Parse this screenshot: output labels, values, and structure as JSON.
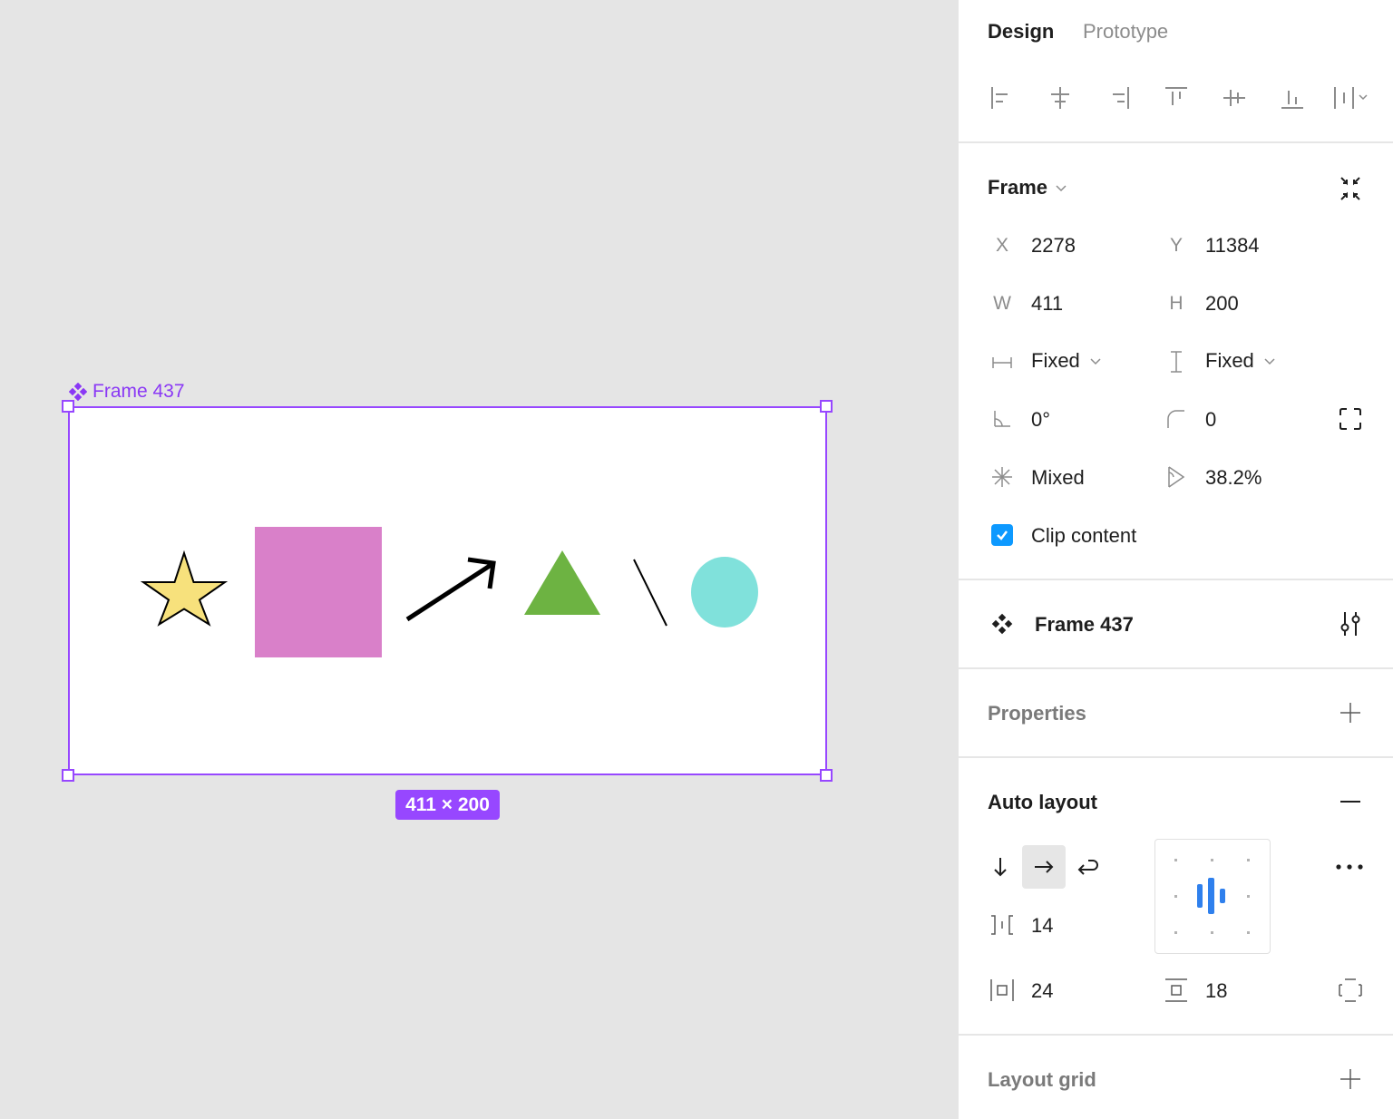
{
  "canvas": {
    "frame_label": "Frame 437",
    "size_badge": "411 × 200",
    "colors": {
      "selection": "#9747ff",
      "star": "#f7e17c",
      "square": "#d980c9",
      "triangle": "#6db342",
      "circle": "#80e1db"
    }
  },
  "panel": {
    "tabs": [
      {
        "label": "Design",
        "active": true
      },
      {
        "label": "Prototype",
        "active": false
      }
    ],
    "align_icons": [
      "align-left-icon",
      "align-horizontal-center-icon",
      "align-right-icon",
      "align-top-icon",
      "align-vertical-center-icon",
      "align-bottom-icon",
      "distribute-icon"
    ],
    "frame": {
      "title": "Frame",
      "x_label": "X",
      "x_value": "2278",
      "y_label": "Y",
      "y_value": "11384",
      "w_label": "W",
      "w_value": "411",
      "h_label": "H",
      "h_value": "200",
      "width_sizing": "Fixed",
      "height_sizing": "Fixed",
      "rotation": "0°",
      "corner_radius": "0",
      "stroke_mixed": "Mixed",
      "opacity_value": "38.2%",
      "clip_content_label": "Clip content",
      "clip_content_checked": true
    },
    "component": {
      "name": "Frame 437"
    },
    "properties": {
      "title": "Properties"
    },
    "auto_layout": {
      "title": "Auto layout",
      "direction": "horizontal",
      "gap": "14",
      "horizontal_padding": "24",
      "vertical_padding": "18",
      "accent": "#2f80ed"
    },
    "layout_grid": {
      "title": "Layout grid"
    }
  }
}
